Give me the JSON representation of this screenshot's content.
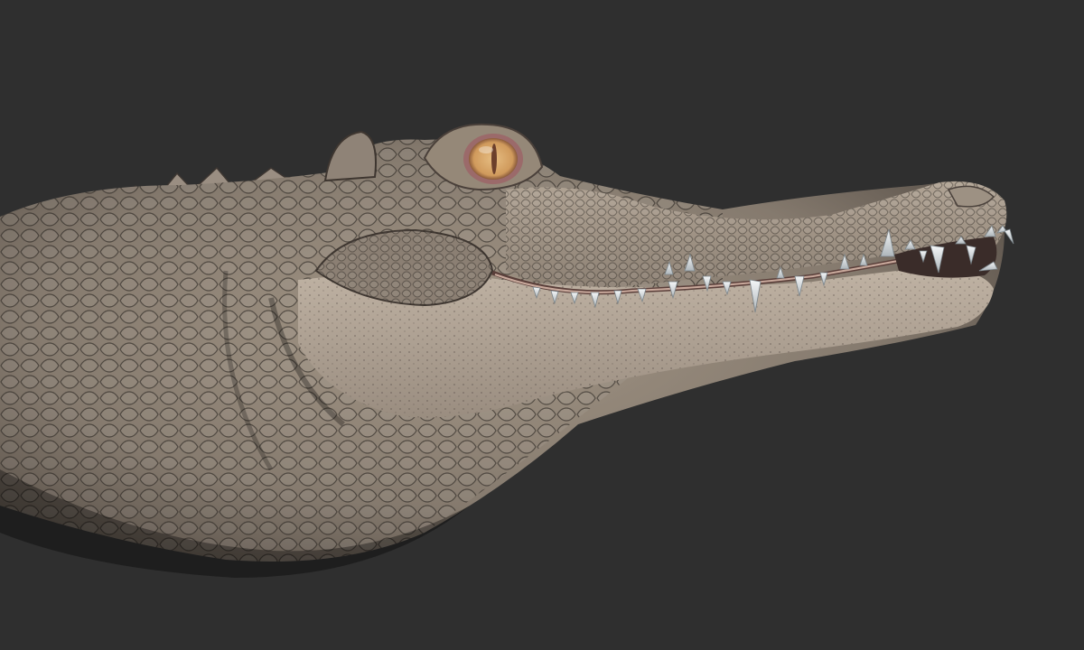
{
  "scene": {
    "subject": "crocodile-head-sculpt",
    "background_color": "#2f2f2f",
    "skin_color": "#8f8377",
    "skin_shadow_color": "#4a423c",
    "jaw_color": "#b3a698",
    "eye_iris_color": "#d6a466",
    "eye_ring_color": "#9b6a6a",
    "tooth_color": "#eef1f3",
    "gum_color": "#c9a99c"
  }
}
